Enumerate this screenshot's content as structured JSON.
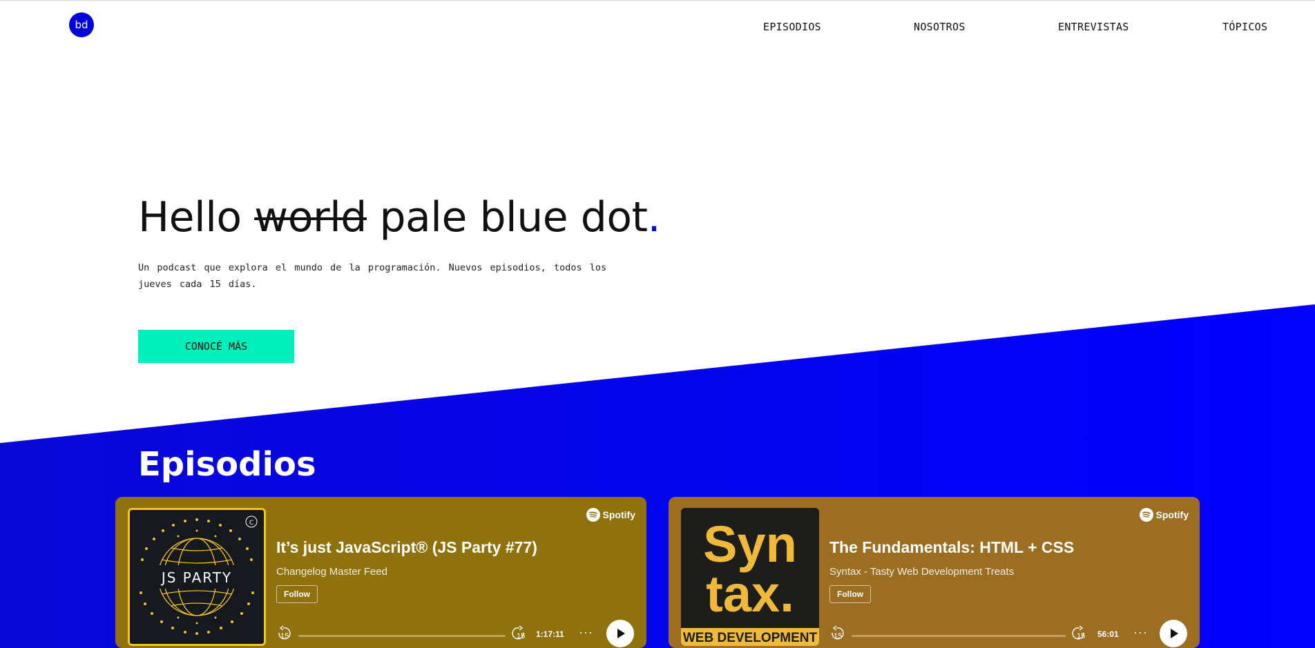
{
  "logo": {
    "text": "bd",
    "icon": "bd-logo-icon"
  },
  "nav": {
    "items": [
      {
        "label": "EPISODIOS"
      },
      {
        "label": "NOSOTROS"
      },
      {
        "label": "ENTREVISTAS"
      },
      {
        "label": "TÓPICOS"
      }
    ]
  },
  "hero": {
    "title_before": "Hello ",
    "title_strike": "world",
    "title_after": " pale blue dot",
    "title_dot": ".",
    "description": "Un podcast que explora el mundo de la programación. Nuevos episodios, todos los jueves cada 15 días.",
    "cta_label": "CONOCÉ MÁS"
  },
  "episodes": {
    "title": "Episodios",
    "cards": [
      {
        "title": "It’s just JavaScript® (JS Party #77)",
        "show": "Changelog Master Feed",
        "follow_label": "Follow",
        "brand": "Spotify",
        "skip_back": "15",
        "skip_forward": "15",
        "duration": "1:17:11",
        "more": "···",
        "cover_text": "JS PARTY",
        "cover_badge": "C",
        "background": "#8f720d"
      },
      {
        "title": "The Fundamentals: HTML + CSS",
        "show": "Syntax - Tasty Web Development Treats",
        "follow_label": "Follow",
        "brand": "Spotify",
        "skip_back": "15",
        "skip_forward": "15",
        "duration": "56:01",
        "more": "···",
        "cover_line1": "Syn",
        "cover_line2": "tax.",
        "cover_footer": "WEB DEVELOPMENT",
        "background": "#9b6e22"
      }
    ]
  },
  "colors": {
    "accent_blue": "#0000ff",
    "cta_green": "#00f0bb",
    "logo_blue": "#0000dd"
  }
}
